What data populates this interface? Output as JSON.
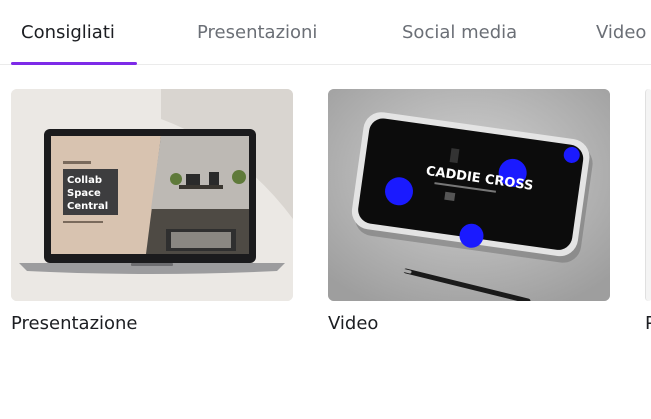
{
  "tabs": [
    {
      "label": "Consigliati",
      "active": true
    },
    {
      "label": "Presentazioni",
      "active": false
    },
    {
      "label": "Social media",
      "active": false
    },
    {
      "label": "Video",
      "active": false
    }
  ],
  "cards": [
    {
      "label": "Presentazione",
      "thumbnail_text": [
        "Collab",
        "Space",
        "Central"
      ]
    },
    {
      "label": "Video",
      "thumbnail_text": [
        "CADDIE CROSS"
      ]
    },
    {
      "label": "P"
    }
  ],
  "colors": {
    "accent": "#7d2ae8",
    "text_active": "#1c1e22",
    "text_inactive": "#6b6f76",
    "video_dots": "#1a1aff"
  }
}
